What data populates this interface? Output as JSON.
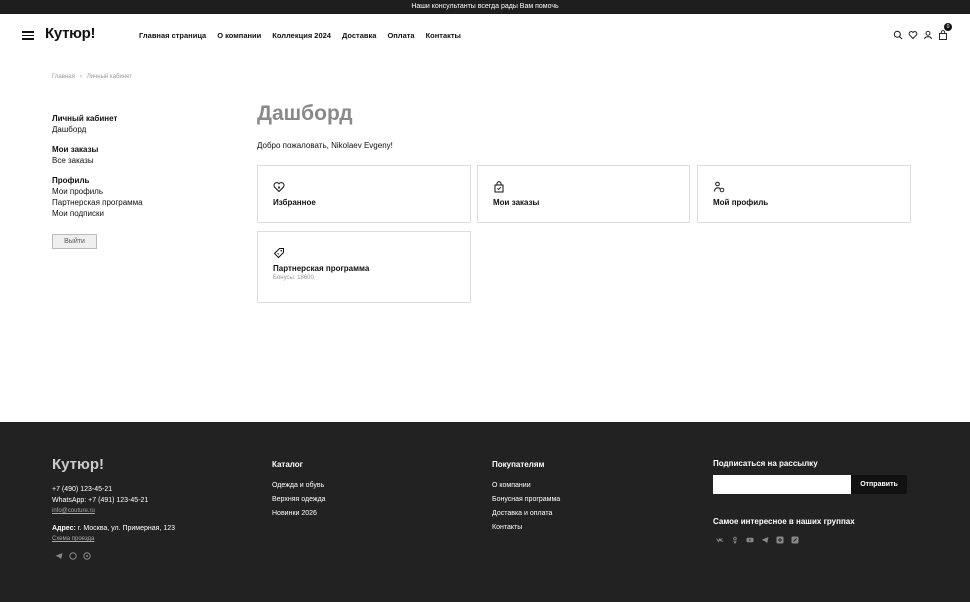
{
  "topbar": {
    "text": "Наши консультанты всегда рады Вам помочь"
  },
  "header": {
    "logo": "Кутюр!",
    "nav": [
      "Главная страница",
      "О компании",
      "Коллекция 2024",
      "Доставка",
      "Оплата",
      "Контакты"
    ],
    "icons": [
      "search-icon",
      "heart-icon",
      "user-icon",
      "cart-icon"
    ],
    "cart_count": "0"
  },
  "breadcrumb": {
    "home": "Главная",
    "current": "Личный кабинет"
  },
  "sidebar": {
    "groups": [
      {
        "title": "Личный кабинет",
        "items": [
          "Дашборд"
        ]
      },
      {
        "title": "Мои заказы",
        "items": [
          "Все заказы"
        ]
      },
      {
        "title": "Профиль",
        "items": [
          "Мои профиль",
          "Партнерская программа",
          "Мои подписки"
        ]
      }
    ],
    "logout": "Выйти"
  },
  "main": {
    "title": "Дашборд",
    "welcome": "Добро пожаловать, Nikolaev Evgeny!",
    "cards": [
      {
        "icon": "heart-icon",
        "title": "Избранное",
        "subtitle": ""
      },
      {
        "icon": "bag-icon",
        "title": "Мои заказы",
        "subtitle": ""
      },
      {
        "icon": "profile-icon",
        "title": "Мой профиль",
        "subtitle": ""
      },
      {
        "icon": "tag-icon",
        "title": "Партнерская программа",
        "subtitle": "Бонусы: 18600"
      }
    ]
  },
  "footer": {
    "logo": "Кутюр!",
    "phone": "+7 (490) 123-45-21",
    "whatsapp": "WhatsApp: +7 (491) 123-45-21",
    "email": "info@couture.ru",
    "address_label": "Адрес:",
    "address": "г. Москва, ул. Примерная, 123",
    "route": "Схема проезда",
    "catalog": {
      "title": "Каталог",
      "items": [
        "Одежда и обувь",
        "Верхняя одежда",
        "Новинки 2026"
      ]
    },
    "buyers": {
      "title": "Покупателям",
      "items": [
        "О компании",
        "Бонусная программа",
        "Доставка и оплата",
        "Контакты"
      ]
    },
    "subscribe": {
      "title": "Подписаться на рассылку",
      "button": "Отправить",
      "placeholder": ""
    },
    "groups_title": "Самое интересное в наших группах"
  },
  "colors": {
    "dark": "#1e1e1e",
    "footer_bg": "#222222",
    "title_gray": "#8a8a8a"
  }
}
